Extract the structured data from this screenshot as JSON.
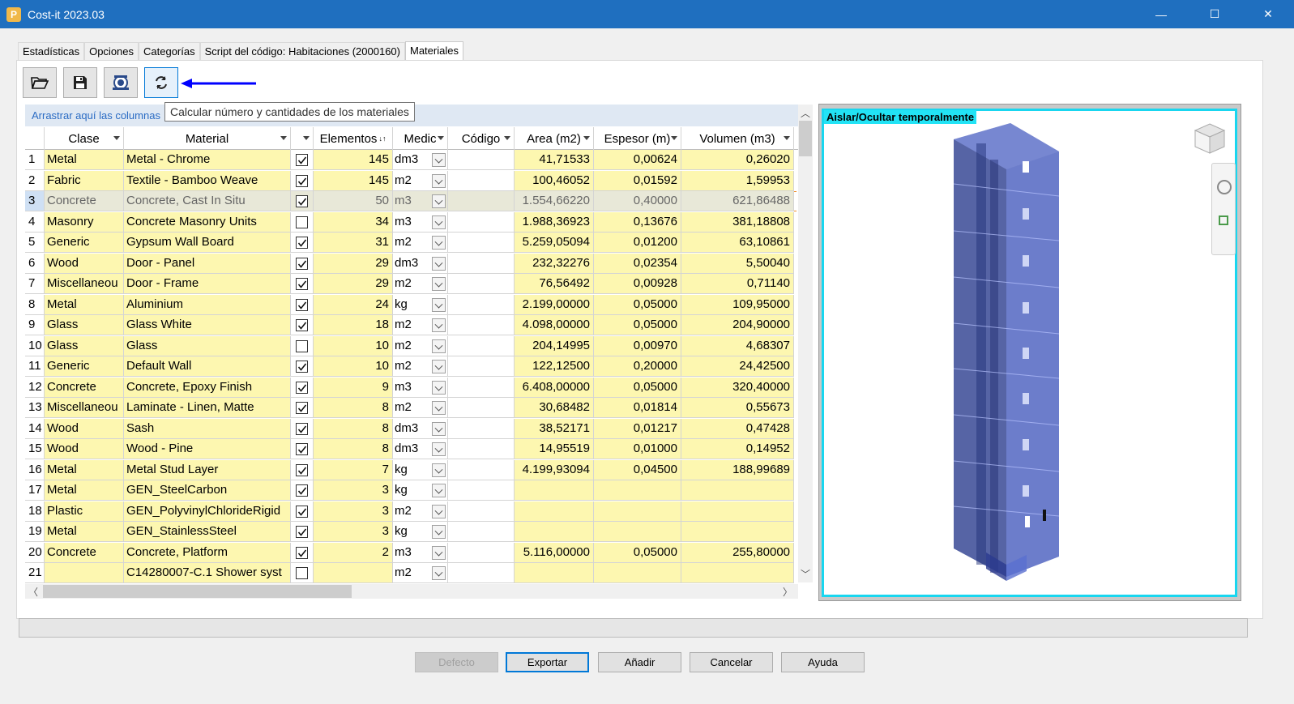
{
  "window": {
    "title": "Cost-it 2023.03",
    "app_icon_glyph": "P",
    "minimize": "—",
    "maximize": "☐",
    "close": "✕"
  },
  "tabs": [
    {
      "label": "Estadísticas"
    },
    {
      "label": "Opciones"
    },
    {
      "label": "Categorías"
    },
    {
      "label": "Script del código: Habitaciones (2000160)"
    },
    {
      "label": "Materiales",
      "active": true
    }
  ],
  "toolbar": {
    "buttons": [
      {
        "icon": "folder-open-icon"
      },
      {
        "icon": "save-icon"
      },
      {
        "icon": "view-icon"
      },
      {
        "icon": "calculate-refresh-icon"
      }
    ],
    "tooltip": "Calcular número y cantidades de los materiales",
    "annotation_arrow_color": "#0000ff"
  },
  "grid": {
    "group_hint": "Arrastrar aquí las columnas",
    "columns": [
      "Clase",
      "Material",
      "",
      "Elementos",
      "Medic",
      "Código",
      "Area (m2)",
      "Espesor (m)",
      "Volumen (m3)"
    ],
    "sort_indicator": "↓↑",
    "selected_row_index": 3,
    "rows": [
      {
        "n": "1",
        "clase": "Metal",
        "material": "Metal - Chrome",
        "checked": true,
        "elementos": "145",
        "medic": "dm3",
        "codigo": "",
        "area": "41,71533",
        "espesor": "0,00624",
        "volumen": "0,26020"
      },
      {
        "n": "2",
        "clase": "Fabric",
        "material": "Textile - Bamboo Weave",
        "checked": true,
        "elementos": "145",
        "medic": "m2",
        "codigo": "",
        "area": "100,46052",
        "espesor": "0,01592",
        "volumen": "1,59953"
      },
      {
        "n": "3",
        "clase": "Concrete",
        "material": "Concrete, Cast In Situ",
        "checked": true,
        "elementos": "50",
        "medic": "m3",
        "codigo": "",
        "area": "1.554,66220",
        "espesor": "0,40000",
        "volumen": "621,86488"
      },
      {
        "n": "4",
        "clase": "Masonry",
        "material": "Concrete Masonry Units",
        "checked": false,
        "elementos": "34",
        "medic": "m3",
        "codigo": "",
        "area": "1.988,36923",
        "espesor": "0,13676",
        "volumen": "381,18808"
      },
      {
        "n": "5",
        "clase": "Generic",
        "material": "Gypsum Wall Board",
        "checked": true,
        "elementos": "31",
        "medic": "m2",
        "codigo": "",
        "area": "5.259,05094",
        "espesor": "0,01200",
        "volumen": "63,10861"
      },
      {
        "n": "6",
        "clase": "Wood",
        "material": "Door - Panel",
        "checked": true,
        "elementos": "29",
        "medic": "dm3",
        "codigo": "",
        "area": "232,32276",
        "espesor": "0,02354",
        "volumen": "5,50040"
      },
      {
        "n": "7",
        "clase": "Miscellaneou",
        "material": "Door - Frame",
        "checked": true,
        "elementos": "29",
        "medic": "m2",
        "codigo": "",
        "area": "76,56492",
        "espesor": "0,00928",
        "volumen": "0,71140"
      },
      {
        "n": "8",
        "clase": "Metal",
        "material": "Aluminium",
        "checked": true,
        "elementos": "24",
        "medic": "kg",
        "codigo": "",
        "area": "2.199,00000",
        "espesor": "0,05000",
        "volumen": "109,95000"
      },
      {
        "n": "9",
        "clase": "Glass",
        "material": "Glass White",
        "checked": true,
        "elementos": "18",
        "medic": "m2",
        "codigo": "",
        "area": "4.098,00000",
        "espesor": "0,05000",
        "volumen": "204,90000"
      },
      {
        "n": "10",
        "clase": "Glass",
        "material": "Glass",
        "checked": false,
        "elementos": "10",
        "medic": "m2",
        "codigo": "",
        "area": "204,14995",
        "espesor": "0,00970",
        "volumen": "4,68307"
      },
      {
        "n": "11",
        "clase": "Generic",
        "material": "Default Wall",
        "checked": true,
        "elementos": "10",
        "medic": "m2",
        "codigo": "",
        "area": "122,12500",
        "espesor": "0,20000",
        "volumen": "24,42500"
      },
      {
        "n": "12",
        "clase": "Concrete",
        "material": "Concrete, Epoxy Finish",
        "checked": true,
        "elementos": "9",
        "medic": "m3",
        "codigo": "",
        "area": "6.408,00000",
        "espesor": "0,05000",
        "volumen": "320,40000"
      },
      {
        "n": "13",
        "clase": "Miscellaneou",
        "material": "Laminate - Linen, Matte",
        "checked": true,
        "elementos": "8",
        "medic": "m2",
        "codigo": "",
        "area": "30,68482",
        "espesor": "0,01814",
        "volumen": "0,55673"
      },
      {
        "n": "14",
        "clase": "Wood",
        "material": "Sash",
        "checked": true,
        "elementos": "8",
        "medic": "dm3",
        "codigo": "",
        "area": "38,52171",
        "espesor": "0,01217",
        "volumen": "0,47428"
      },
      {
        "n": "15",
        "clase": "Wood",
        "material": "Wood - Pine",
        "checked": true,
        "elementos": "8",
        "medic": "dm3",
        "codigo": "",
        "area": "14,95519",
        "espesor": "0,01000",
        "volumen": "0,14952"
      },
      {
        "n": "16",
        "clase": "Metal",
        "material": "Metal Stud Layer",
        "checked": true,
        "elementos": "7",
        "medic": "kg",
        "codigo": "",
        "area": "4.199,93094",
        "espesor": "0,04500",
        "volumen": "188,99689"
      },
      {
        "n": "17",
        "clase": "Metal",
        "material": "GEN_SteelCarbon",
        "checked": true,
        "elementos": "3",
        "medic": "kg",
        "codigo": "",
        "area": "",
        "espesor": "",
        "volumen": ""
      },
      {
        "n": "18",
        "clase": "Plastic",
        "material": "GEN_PolyvinylChlorideRigid",
        "checked": true,
        "elementos": "3",
        "medic": "m2",
        "codigo": "",
        "area": "",
        "espesor": "",
        "volumen": ""
      },
      {
        "n": "19",
        "clase": "Metal",
        "material": "GEN_StainlessSteel",
        "checked": true,
        "elementos": "3",
        "medic": "kg",
        "codigo": "",
        "area": "",
        "espesor": "",
        "volumen": ""
      },
      {
        "n": "20",
        "clase": "Concrete",
        "material": "Concrete, Platform",
        "checked": true,
        "elementos": "2",
        "medic": "m3",
        "codigo": "",
        "area": "5.116,00000",
        "espesor": "0,05000",
        "volumen": "255,80000"
      },
      {
        "n": "21",
        "clase": "",
        "material": "C14280007-C.1 Shower syst",
        "checked": false,
        "elementos": "",
        "medic": "m2",
        "codigo": "",
        "area": "",
        "espesor": "",
        "volumen": ""
      }
    ]
  },
  "viewer": {
    "label": "Aislar/Ocultar temporalmente",
    "accent_color": "#19d6ef",
    "building_color": "#3a4fae"
  },
  "buttons": {
    "defecto": "Defecto",
    "exportar": "Exportar",
    "anadir": "Añadir",
    "cancelar": "Cancelar",
    "ayuda": "Ayuda"
  }
}
